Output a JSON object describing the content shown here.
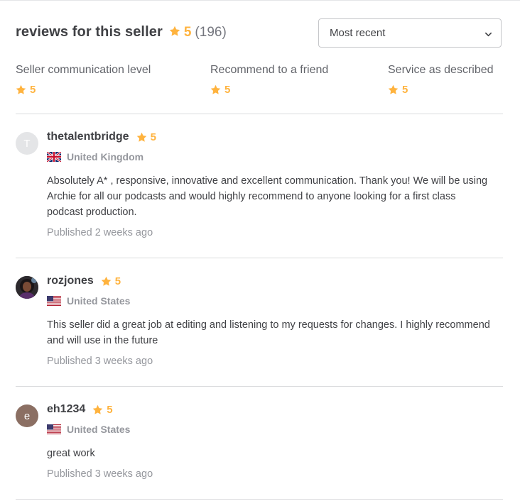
{
  "header": {
    "title": "reviews for this seller",
    "rating": "5",
    "count": "(196)"
  },
  "sort": {
    "selected": "Most recent"
  },
  "metrics": [
    {
      "label": "Seller communication level",
      "value": "5"
    },
    {
      "label": "Recommend to a friend",
      "value": "5"
    },
    {
      "label": "Service as described",
      "value": "5"
    }
  ],
  "reviews": [
    {
      "avatar_letter": "T",
      "username": "thetalentbridge",
      "rating": "5",
      "country": "United Kingdom",
      "flag_icon": "uk-flag-icon",
      "text": "Absolutely A* , responsive, innovative and excellent communication. Thank you! We will be using Archie for all our podcasts and would highly recommend to anyone looking for a first class podcast production.",
      "published": "Published 2 weeks ago"
    },
    {
      "avatar_letter": "",
      "username": "rozjones",
      "rating": "5",
      "country": "United States",
      "flag_icon": "us-flag-icon",
      "text": "This seller did a great job at editing and listening to my requests for changes. I highly recommend and will use in the future",
      "published": "Published 3 weeks ago"
    },
    {
      "avatar_letter": "e",
      "username": "eh1234",
      "rating": "5",
      "country": "United States",
      "flag_icon": "us-flag-icon",
      "text": "great work",
      "published": "Published 3 weeks ago"
    }
  ],
  "colors": {
    "star": "#ffb33e",
    "text": "#404145",
    "muted": "#95979d"
  }
}
